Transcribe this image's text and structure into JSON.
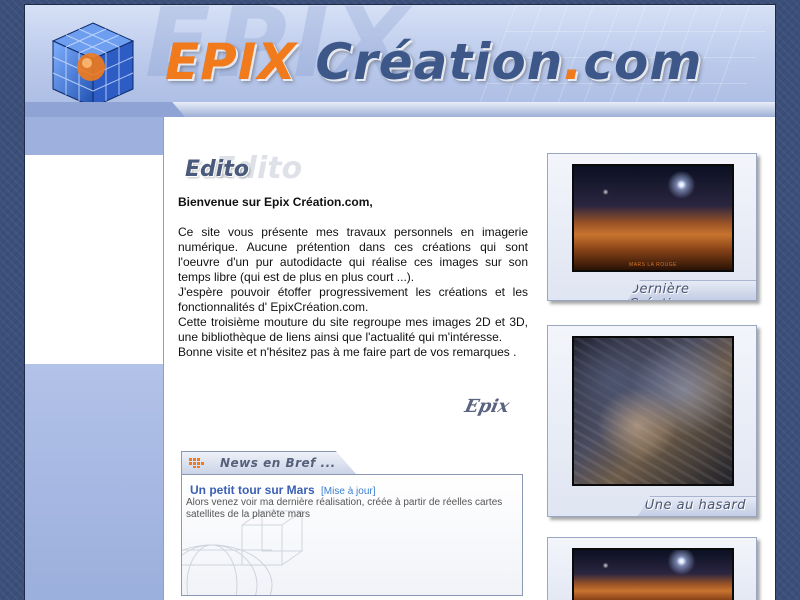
{
  "header": {
    "logo_epix": "EPIX",
    "logo_creation": "Création",
    "logo_dot": ".",
    "logo_com": "com",
    "watermark": "EPIX"
  },
  "edito": {
    "title": "Edito",
    "greeting": "Bienvenue sur Epix Création.com,",
    "paragraphs": [
      "Ce site vous présente mes travaux personnels en imagerie numérique. Aucune prétention dans ces créations qui sont l'oeuvre d'un pur autodidacte qui réalise ces images sur son temps libre (qui est de plus en plus court ...).",
      "J'espère pouvoir étoffer progressivement les créations et les fonctionnalités d' EpixCréation.com.",
      "Cette troisième mouture du site regroupe mes images 2D et 3D, une bibliothèque de liens ainsi que l'actualité qui m'intéresse.",
      "Bonne visite et n'hésitez pas à me faire part de vos remarques ."
    ],
    "signature": "Epix"
  },
  "news": {
    "tab_label": "News en Bref ...",
    "item_title": "Un petit tour sur Mars",
    "item_tag": "[Mise à jour]",
    "item_text": "Alors venez voir ma dernière réalisation, créée à partir de réelles cartes satellites de la planète mars"
  },
  "panels": {
    "latest_label": "Dernière Création",
    "latest_caption": "MARS LA ROUGE",
    "random_label": "Une au hasard"
  },
  "colors": {
    "accent_orange": "#f07a1c",
    "accent_blue": "#3c5788",
    "page_background": "#3b4f7a",
    "link_blue": "#3a5fb4"
  }
}
